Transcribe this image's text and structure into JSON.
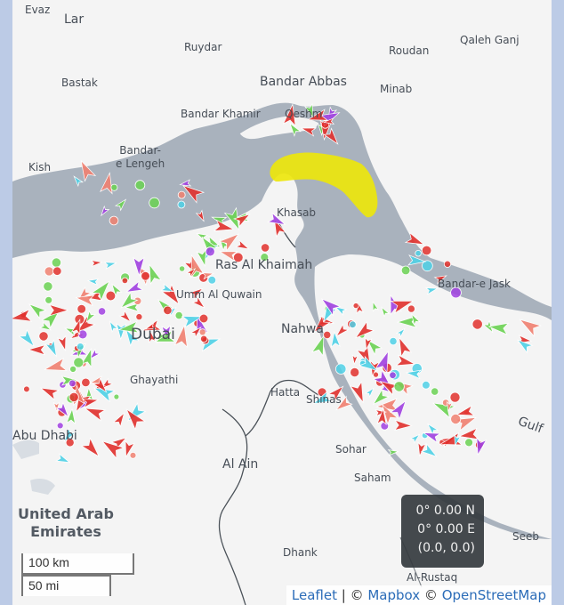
{
  "places": {
    "evaz": "Evaz",
    "lar": "Lar",
    "ruydar": "Ruydar",
    "roudan": "Roudan",
    "qaleh_ganj": "Qaleh Ganj",
    "bastak": "Bastak",
    "bandar_abbas": "Bandar Abbas",
    "minab": "Minab",
    "bandar_khamir": "Bandar Khamir",
    "qeshm": "Qeshm",
    "bandar_lengeh": "Bandar-\ne Lengeh",
    "kish": "Kish",
    "khasab": "Khasab",
    "ras_al_khaimah": "Ras Al Khaimah",
    "umm_al_quwain": "Umm Al Quwain",
    "dubai": "Dubai",
    "bandar_e_jask": "Bandar-e Jask",
    "nahwa": "Nahwa",
    "ghayathi": "Ghayathi",
    "hatta": "Hatta",
    "shinas": "Shinas",
    "abu_dhabi": "Abu Dhabi",
    "sohar": "Sohar",
    "al_ain": "Al Ain",
    "saham": "Saham",
    "gulf": "Gulf",
    "dhank": "Dhank",
    "seeb": "Seeb",
    "al_rustaq": "Al-Rustaq",
    "uae": "United Arab\nEmirates"
  },
  "coordinates": {
    "lat": "0° 0.00 N",
    "lon": "0° 0.00 E",
    "pair": "(0.0, 0.0)"
  },
  "scale": {
    "km": "100 km",
    "mi": "50 mi"
  },
  "attribution": {
    "leaflet": "Leaflet",
    "sep1": " | © ",
    "mapbox": "Mapbox",
    "sep2": " © ",
    "osm": "OpenStreetMap"
  },
  "colors": {
    "sea": "#a9b2bd",
    "land": "#f4f4f4",
    "border": "#4a5158",
    "cargo_red": "#e0302c",
    "tanker_green": "#6ad152",
    "passenger_cyan": "#4fd0e6",
    "highlight_yellow": "#ede60c",
    "other_purple": "#a040e0",
    "fishing_salmon": "#f08070"
  },
  "vessels": {
    "marker_types": [
      "triangle-arrow",
      "circle"
    ],
    "categories": [
      "red",
      "green",
      "cyan",
      "purple",
      "salmon"
    ]
  }
}
